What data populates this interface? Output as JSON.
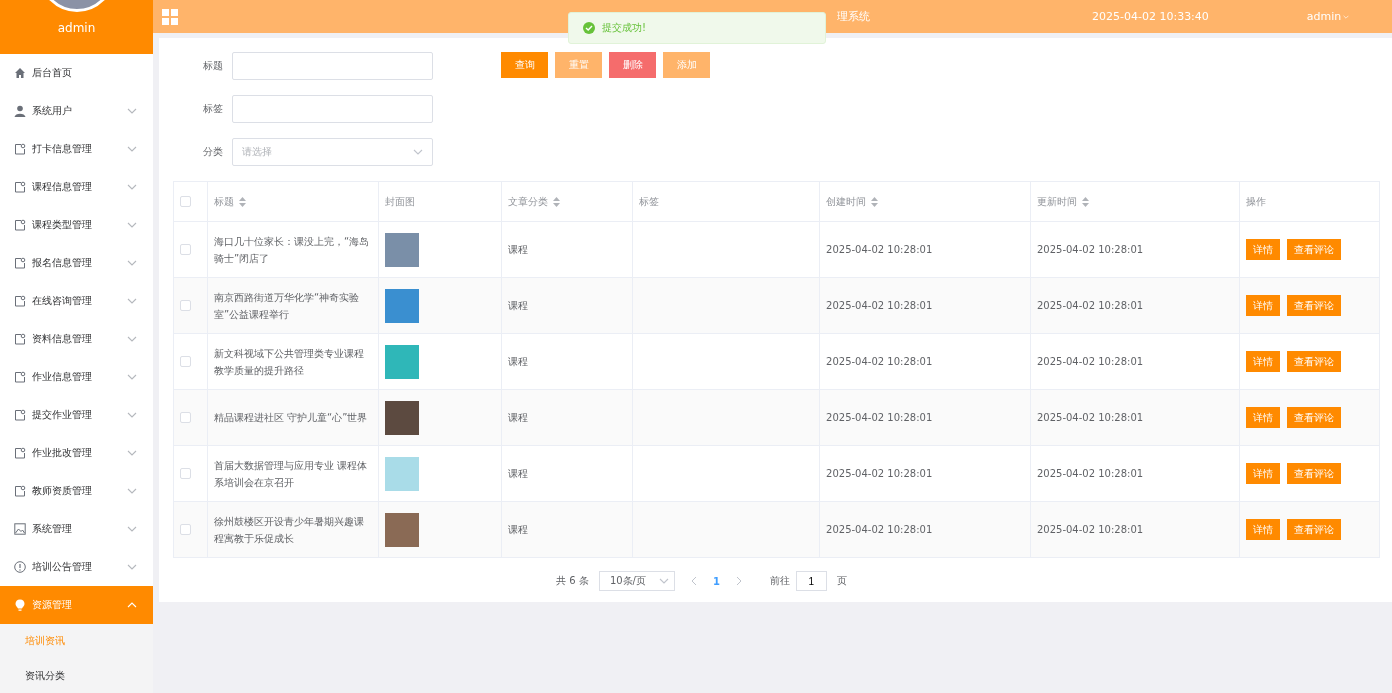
{
  "sidebar": {
    "user": "admin",
    "items": [
      {
        "label": "后台首页",
        "has_children": false,
        "expanded": false,
        "selected": false
      },
      {
        "label": "系统用户",
        "has_children": true,
        "expanded": false,
        "selected": false
      },
      {
        "label": "打卡信息管理",
        "has_children": true,
        "expanded": false,
        "selected": false
      },
      {
        "label": "课程信息管理",
        "has_children": true,
        "expanded": false,
        "selected": false
      },
      {
        "label": "课程类型管理",
        "has_children": true,
        "expanded": false,
        "selected": false
      },
      {
        "label": "报名信息管理",
        "has_children": true,
        "expanded": false,
        "selected": false
      },
      {
        "label": "在线咨询管理",
        "has_children": true,
        "expanded": false,
        "selected": false
      },
      {
        "label": "资料信息管理",
        "has_children": true,
        "expanded": false,
        "selected": false
      },
      {
        "label": "作业信息管理",
        "has_children": true,
        "expanded": false,
        "selected": false
      },
      {
        "label": "提交作业管理",
        "has_children": true,
        "expanded": false,
        "selected": false
      },
      {
        "label": "作业批改管理",
        "has_children": true,
        "expanded": false,
        "selected": false
      },
      {
        "label": "教师资质管理",
        "has_children": true,
        "expanded": false,
        "selected": false
      },
      {
        "label": "系统管理",
        "has_children": true,
        "expanded": false,
        "selected": false
      },
      {
        "label": "培训公告管理",
        "has_children": true,
        "expanded": false,
        "selected": false
      },
      {
        "label": "资源管理",
        "has_children": true,
        "expanded": true,
        "selected": true,
        "children": [
          {
            "label": "培训资讯",
            "selected": true
          },
          {
            "label": "资讯分类",
            "selected": false
          }
        ]
      }
    ]
  },
  "header": {
    "title": "理系统",
    "datetime": "2025-04-02 10:33:40",
    "user": "admin"
  },
  "toast": {
    "message": "提交成功!"
  },
  "search": {
    "fields": [
      {
        "kind": "input",
        "label": "标题"
      },
      {
        "kind": "input",
        "label": "标签"
      },
      {
        "kind": "select",
        "label": "分类",
        "placeholder": "请选择"
      }
    ],
    "buttons": [
      {
        "label": "查询",
        "color": "#ff8a00"
      },
      {
        "label": "重置",
        "color": "#ffb46a"
      },
      {
        "label": "删除",
        "color": "#f56c6c"
      },
      {
        "label": "添加",
        "color": "#ffb46a"
      }
    ]
  },
  "table": {
    "select_all": false,
    "columns": [
      {
        "label": "标题",
        "sortable": true
      },
      {
        "label": "封面图",
        "sortable": false
      },
      {
        "label": "文章分类",
        "sortable": true
      },
      {
        "label": "标签",
        "sortable": false
      },
      {
        "label": "创建时间",
        "sortable": true
      },
      {
        "label": "更新时间",
        "sortable": true
      },
      {
        "label": "操作",
        "sortable": false
      }
    ],
    "rows": [
      {
        "checked": false,
        "title": "海口几十位家长：课没上完，“海岛骑士”闭店了",
        "category": "课程",
        "created": "2025-04-02 10:28:01",
        "updated": "2025-04-02 10:28:01",
        "actions": [
          "详情",
          "查看评论"
        ]
      },
      {
        "checked": false,
        "title": "南京西路街道万华化学“神奇实验室”公益课程举行",
        "category": "课程",
        "created": "2025-04-02 10:28:01",
        "updated": "2025-04-02 10:28:01",
        "actions": [
          "详情",
          "查看评论"
        ]
      },
      {
        "checked": false,
        "title": "新文科视域下公共管理类专业课程教学质量的提升路径",
        "category": "课程",
        "created": "2025-04-02 10:28:01",
        "updated": "2025-04-02 10:28:01",
        "actions": [
          "详情",
          "查看评论"
        ]
      },
      {
        "checked": false,
        "title": "精品课程进社区 守护儿童“心”世界",
        "category": "课程",
        "created": "2025-04-02 10:28:01",
        "updated": "2025-04-02 10:28:01",
        "actions": [
          "详情",
          "查看评论"
        ]
      },
      {
        "checked": false,
        "title": "首届大数据管理与应用专业 课程体系培训会在京召开",
        "category": "课程",
        "created": "2025-04-02 10:28:01",
        "updated": "2025-04-02 10:28:01",
        "actions": [
          "详情",
          "查看评论"
        ]
      },
      {
        "checked": false,
        "title": "徐州鼓楼区开设青少年暑期兴趣课程寓教于乐促成长",
        "category": "课程",
        "created": "2025-04-02 10:28:01",
        "updated": "2025-04-02 10:28:01",
        "actions": [
          "详情",
          "查看评论"
        ]
      }
    ]
  },
  "pagination": {
    "total": "共 6 条",
    "page_size": "10条/页",
    "pages": [
      {
        "label": "1",
        "selected": true
      }
    ],
    "goto_label": "前往",
    "goto_value": "1",
    "goto_suffix": "页"
  }
}
